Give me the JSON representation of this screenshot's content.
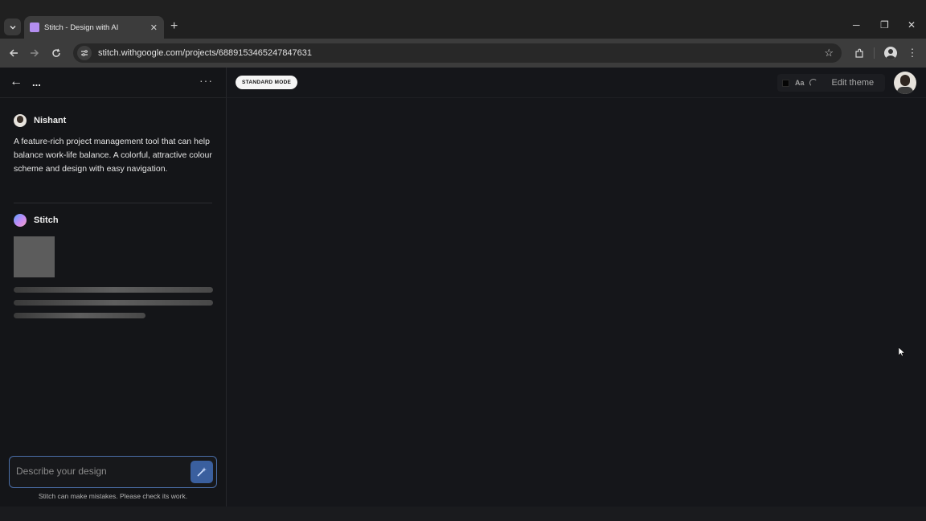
{
  "browser": {
    "tab_title": "Stitch - Design with AI",
    "tab_close": "✕",
    "new_tab": "+",
    "url": "stitch.withgoogle.com/projects/6889153465247847631",
    "window_minimize": "─",
    "window_restore": "❐",
    "window_close": "✕"
  },
  "sidebar": {
    "project_title": "...",
    "more_label": "···",
    "user_message": {
      "author": "Nishant",
      "text": "A feature-rich project management tool that can help balance work-life balance. A colorful, attractive colour scheme and design with easy navigation."
    },
    "assistant_message": {
      "author": "Stitch",
      "loading_lines_fill": [
        1.0,
        1.0,
        0.66
      ]
    },
    "composer": {
      "placeholder": "Describe your design",
      "value": ""
    },
    "disclaimer": "Stitch can make mistakes. Please check its work."
  },
  "canvas": {
    "mode_label": "STANDARD MODE",
    "theme_font_label": "Aa",
    "edit_theme_label": "Edit theme"
  },
  "colors": {
    "accent": "#3a5f9e",
    "composer_border": "#4a6ea8",
    "background": "#131416"
  }
}
